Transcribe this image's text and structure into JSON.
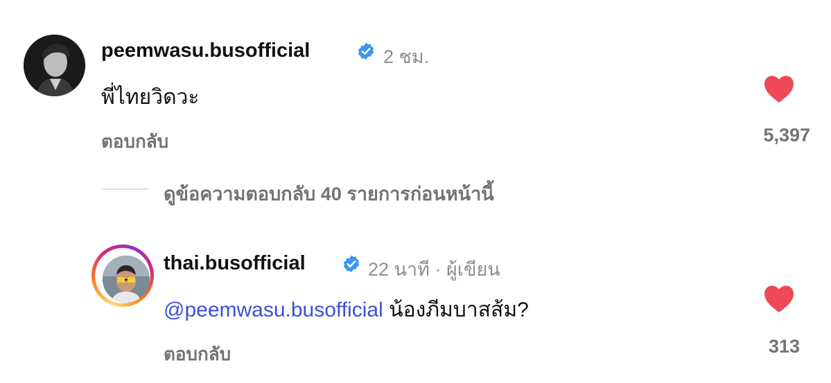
{
  "comments": [
    {
      "username": "peemwasu.busofficial",
      "time": "2 ชม.",
      "text": "พี่ไทยวิดวะ",
      "reply_label": "ตอบกลับ",
      "like_count": "5,397"
    }
  ],
  "view_replies": "ดูข้อความตอบกลับ 40 รายการก่อนหน้านี้",
  "reply": {
    "username": "thai.busofficial",
    "meta": "22 นาที · ผู้เขียน",
    "mention": "@peemwasu.busofficial",
    "text": "น้องภีมบาสส้ม?",
    "reply_label": "ตอบกลับ",
    "like_count": "313"
  },
  "colors": {
    "heart": "#ed4956",
    "verified": "#3897f0",
    "mention": "#3a50d9"
  },
  "icons": [
    "verified-badge-icon",
    "heart-icon"
  ]
}
